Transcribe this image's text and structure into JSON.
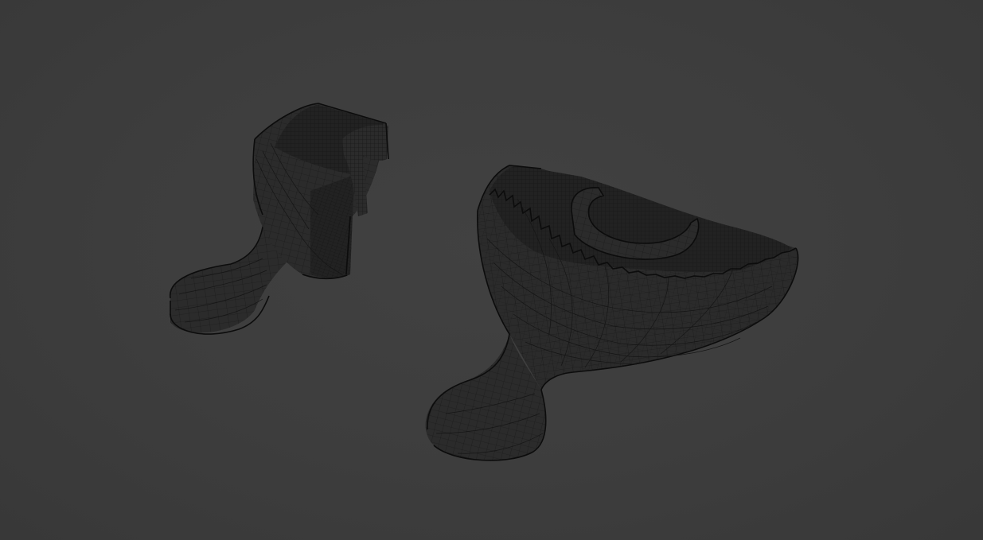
{
  "viewport": {
    "background_color": "#3d3d3d",
    "shading_mode": "wireframe"
  },
  "objects": [
    {
      "id": "impression-tray-small",
      "wire_color": "#151515"
    },
    {
      "id": "impression-tray-large",
      "wire_color": "#151515"
    }
  ]
}
